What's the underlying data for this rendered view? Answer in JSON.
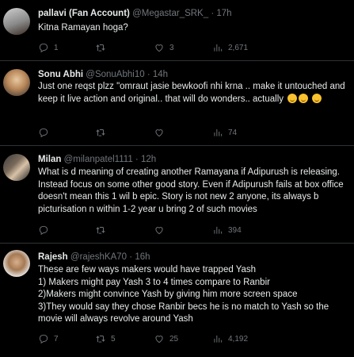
{
  "tweets": [
    {
      "name": "pallavi (Fan Account)",
      "handle": "@Megastar_SRK_",
      "sep": "·",
      "time": "17h",
      "text": "Kitna Ramayan hoga?",
      "replies": "1",
      "retweets": "",
      "likes": "3",
      "views": "2,671"
    },
    {
      "name": "Sonu Abhi",
      "handle": "@SonuAbhi10",
      "sep": "·",
      "time": "14h",
      "text": "Just one reqst plzz \"omraut jasie bewkoofi nhi krna .. make it untouched and keep it live action and original.. that will do wonders.. actually",
      "replies": "",
      "retweets": "",
      "likes": "",
      "views": "74"
    },
    {
      "name": "Milan",
      "handle": "@milanpatel1111",
      "sep": "·",
      "time": "12h",
      "text": "What is d meaning of creating another Ramayana if Adipurush is releasing. Instead focus on some other good story. Even if Adipurush fails at box office doesn't mean this 1 wil b epic. Story is not new 2 anyone, its always b picturisation n within 1-2 year u bring 2 of such movies",
      "replies": "",
      "retweets": "",
      "likes": "",
      "views": "394"
    },
    {
      "name": "Rajesh",
      "handle": "@rajeshKA70",
      "sep": "·",
      "time": "16h",
      "text_lines": [
        "These are few ways makers would have trapped Yash",
        "1) Makers might pay Yash 3 to 4 times compare to Ranbir",
        "2)Makers might convince Yash by giving him more screen space",
        "3)They would say they chose Ranbir becs he is no match to Yash so the movie will always revolve around Yash"
      ],
      "replies": "7",
      "retweets": "5",
      "likes": "25",
      "views": "4,192"
    }
  ],
  "colors": {
    "bg": "#000000",
    "text": "#e7e9ea",
    "muted": "#71767b",
    "divider": "#2f3336"
  }
}
